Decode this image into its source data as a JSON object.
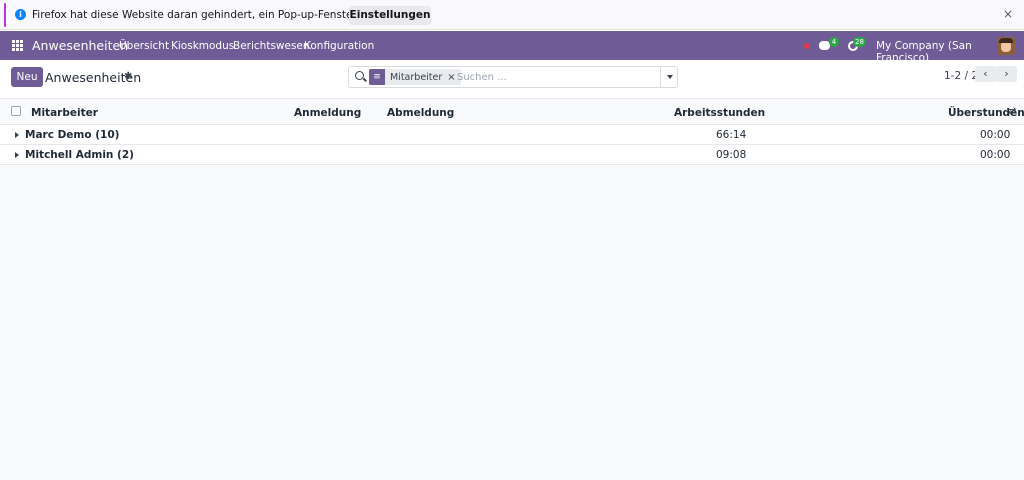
{
  "notification": {
    "message": "Firefox hat diese Website daran gehindert, ein Pop-up-Fenster zu öffnen.",
    "settings_label": "Einstellungen",
    "close_label": "×"
  },
  "navbar": {
    "app_name": "Anwesenheiten",
    "menu": [
      "Übersicht",
      "Kioskmodus",
      "Berichtswesen",
      "Konfiguration"
    ],
    "chat_count": "4",
    "activity_count": "28",
    "company": "My Company (San Francisco)"
  },
  "control_panel": {
    "new_label": "Neu",
    "title": "Anwesenheiten",
    "facet_label": "Mitarbeiter",
    "facet_remove": "×",
    "search_placeholder": "Suchen ...",
    "pager": "1-2 / 2",
    "prev": "‹",
    "next": "›"
  },
  "table": {
    "headers": [
      "Mitarbeiter",
      "Anmeldung",
      "Abmeldung",
      "Arbeitsstunden",
      "Überstunden"
    ],
    "groups": [
      {
        "name": "Marc Demo (10)",
        "hours": "66:14",
        "overtime": "00:00"
      },
      {
        "name": "Mitchell Admin (2)",
        "hours": "09:08",
        "overtime": "00:00"
      }
    ]
  },
  "colors": {
    "brand": "#6f5c96",
    "badge": "#28a745",
    "alert_dot": "#e0394f"
  },
  "icons": [
    "info-icon",
    "close-icon",
    "apps-icon",
    "chat-icon",
    "activity-icon",
    "gear-icon",
    "search-icon",
    "layers-icon",
    "chevron-down-icon",
    "chevron-left-icon",
    "chevron-right-icon",
    "column-settings-icon",
    "caret-right-icon"
  ]
}
